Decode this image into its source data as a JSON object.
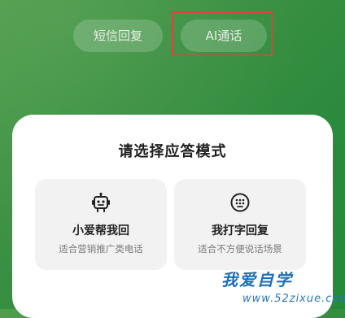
{
  "mode_tabs": [
    {
      "label": "短信回复"
    },
    {
      "label": "AI通话"
    }
  ],
  "sheet": {
    "title": "请选择应答模式",
    "options": [
      {
        "label": "小爱帮我回",
        "description": "适合营销推广类电话",
        "icon": "robot-icon"
      },
      {
        "label": "我打字回复",
        "description": "适合不方便说话场景",
        "icon": "keyboard-icon"
      }
    ]
  },
  "watermark": {
    "logo": "我爱自学",
    "url": "www.52zixue.com"
  },
  "colors": {
    "background": "#2f8f3f",
    "highlight": "#d9463f",
    "sheet": "#ffffff",
    "card": "#f2f2f2"
  }
}
